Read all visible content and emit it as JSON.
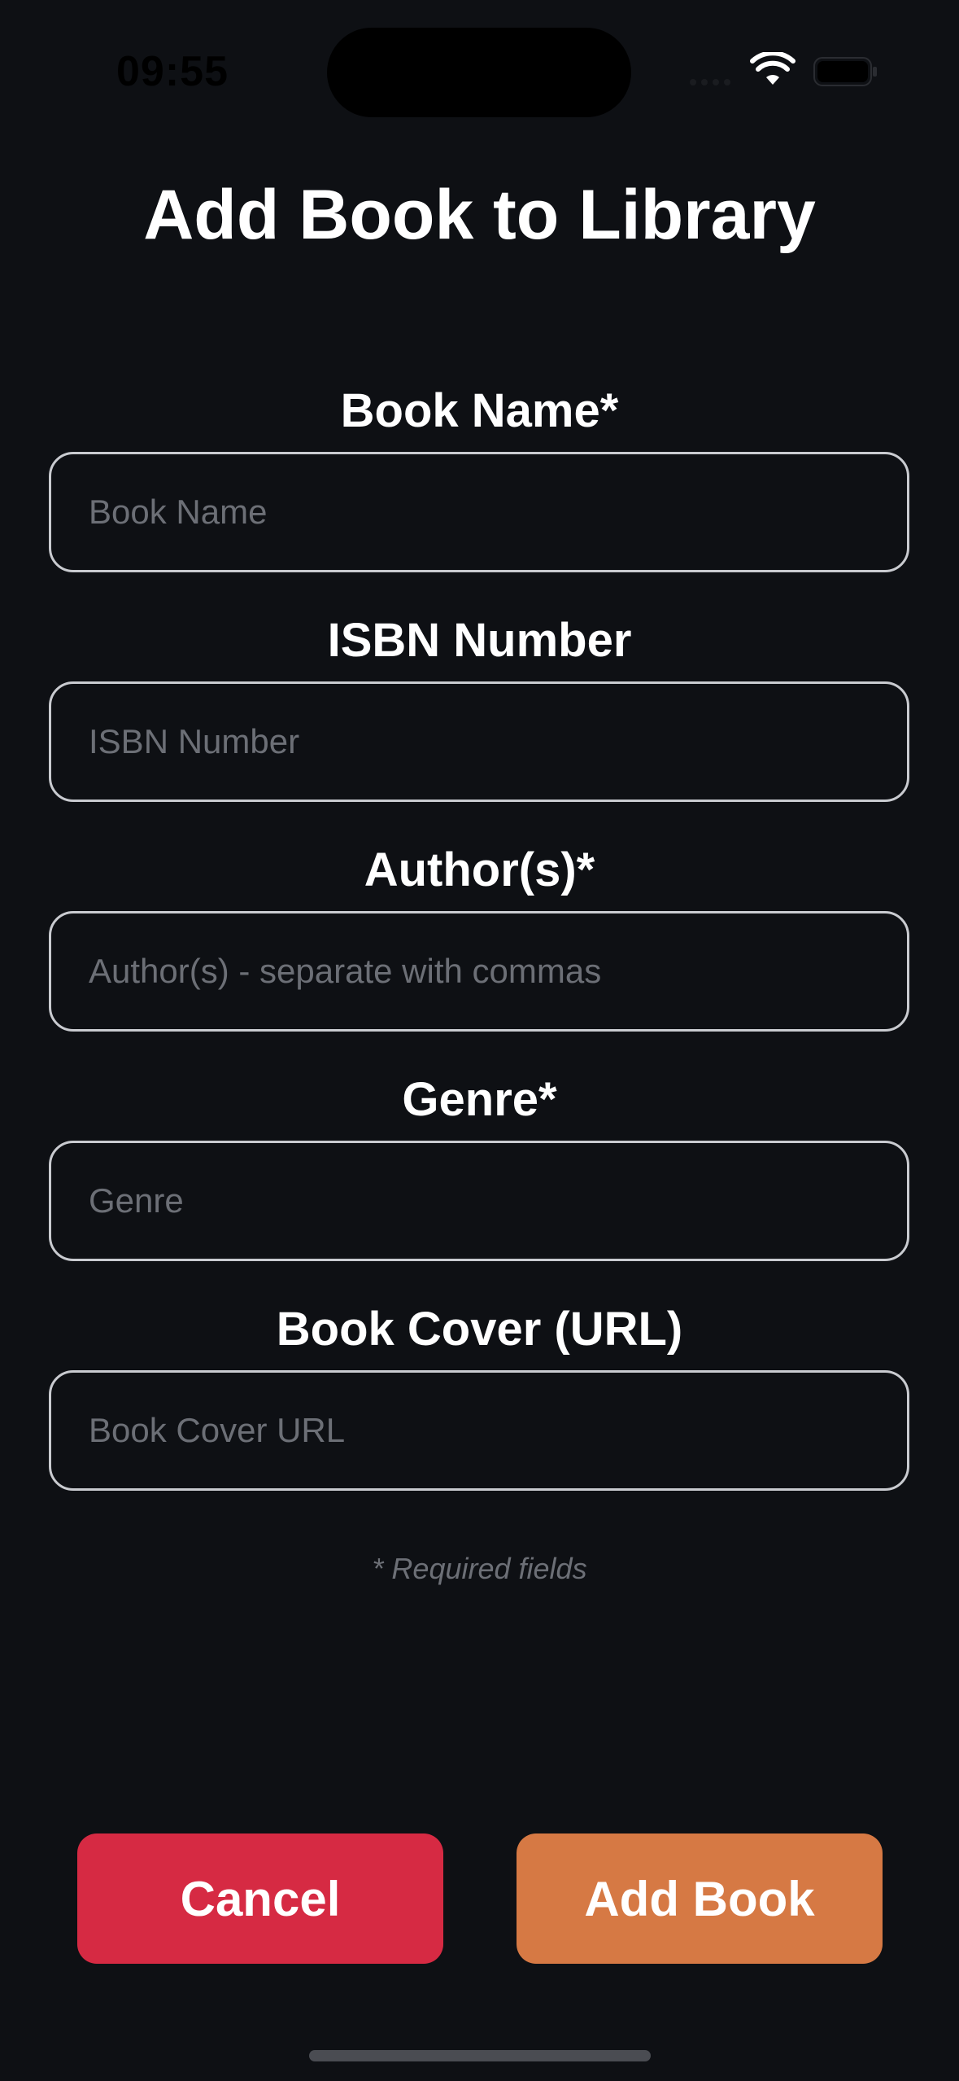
{
  "status_bar": {
    "time": "09:55"
  },
  "title": "Add Book to Library",
  "form": {
    "fields": [
      {
        "label": "Book Name*",
        "placeholder": "Book Name",
        "value": ""
      },
      {
        "label": "ISBN Number",
        "placeholder": "ISBN Number",
        "value": ""
      },
      {
        "label": "Author(s)*",
        "placeholder": "Author(s) - separate with commas",
        "value": ""
      },
      {
        "label": "Genre*",
        "placeholder": "Genre",
        "value": ""
      },
      {
        "label": "Book Cover (URL)",
        "placeholder": "Book Cover URL",
        "value": ""
      }
    ],
    "required_note": "* Required fields"
  },
  "buttons": {
    "cancel_label": "Cancel",
    "add_label": "Add Book"
  },
  "colors": {
    "background": "#0e1014",
    "cancel": "#d62a43",
    "add": "#d67944",
    "input_border": "#c9cbd0",
    "placeholder": "#6c6f76"
  },
  "icons": [
    "signal-icon",
    "wifi-icon",
    "battery-icon"
  ]
}
